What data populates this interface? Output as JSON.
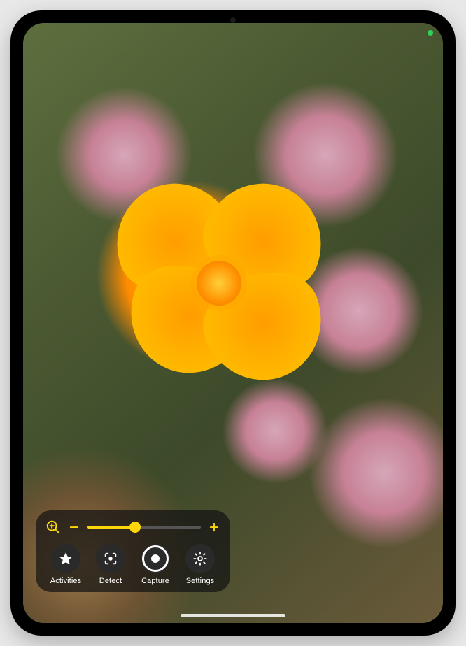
{
  "accent_color": "#ffd60a",
  "panel_bg": "rgba(20,20,20,0.72)",
  "zoom": {
    "icon": "magnifier-plus-icon",
    "minus_icon": "minus-icon",
    "plus_icon": "plus-icon",
    "value_percent": 42
  },
  "toolbar": {
    "items": [
      {
        "icon": "star-icon",
        "label": "Activities"
      },
      {
        "icon": "detect-icon",
        "label": "Detect"
      },
      {
        "icon": "capture-icon",
        "label": "Capture"
      },
      {
        "icon": "gear-icon",
        "label": "Settings"
      }
    ]
  },
  "status": {
    "camera_in_use": true
  }
}
